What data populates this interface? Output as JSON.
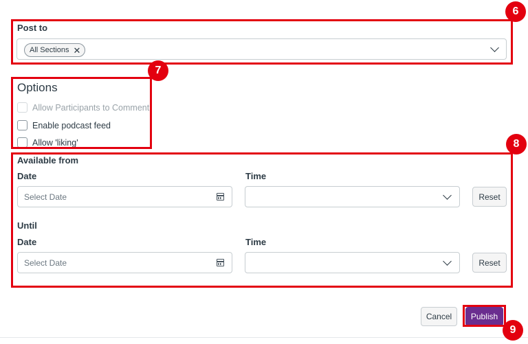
{
  "post_to": {
    "label": "Post to",
    "chips": [
      {
        "label": "All Sections"
      }
    ],
    "chip_remove_glyph": "✕"
  },
  "options": {
    "heading": "Options",
    "items": [
      {
        "label": "Allow Participants to Comment",
        "checked": false,
        "disabled": true
      },
      {
        "label": "Enable podcast feed",
        "checked": false,
        "disabled": false
      },
      {
        "label": "Allow 'liking'",
        "checked": false,
        "disabled": false
      }
    ]
  },
  "available_from": {
    "heading": "Available from",
    "date_label": "Date",
    "date_placeholder": "Select Date",
    "time_label": "Time",
    "time_value": "",
    "reset_label": "Reset"
  },
  "until": {
    "heading": "Until",
    "date_label": "Date",
    "date_placeholder": "Select Date",
    "time_label": "Time",
    "time_value": "",
    "reset_label": "Reset"
  },
  "footer": {
    "cancel_label": "Cancel",
    "publish_label": "Publish"
  },
  "annotations": [
    {
      "number": "6"
    },
    {
      "number": "7"
    },
    {
      "number": "8"
    },
    {
      "number": "9"
    }
  ],
  "colors": {
    "highlight": "#e3000f",
    "primary_button": "#6a2d8f",
    "text": "#2d3b45"
  },
  "icons": [
    "chevron-down-icon",
    "calendar-icon",
    "close-icon"
  ]
}
